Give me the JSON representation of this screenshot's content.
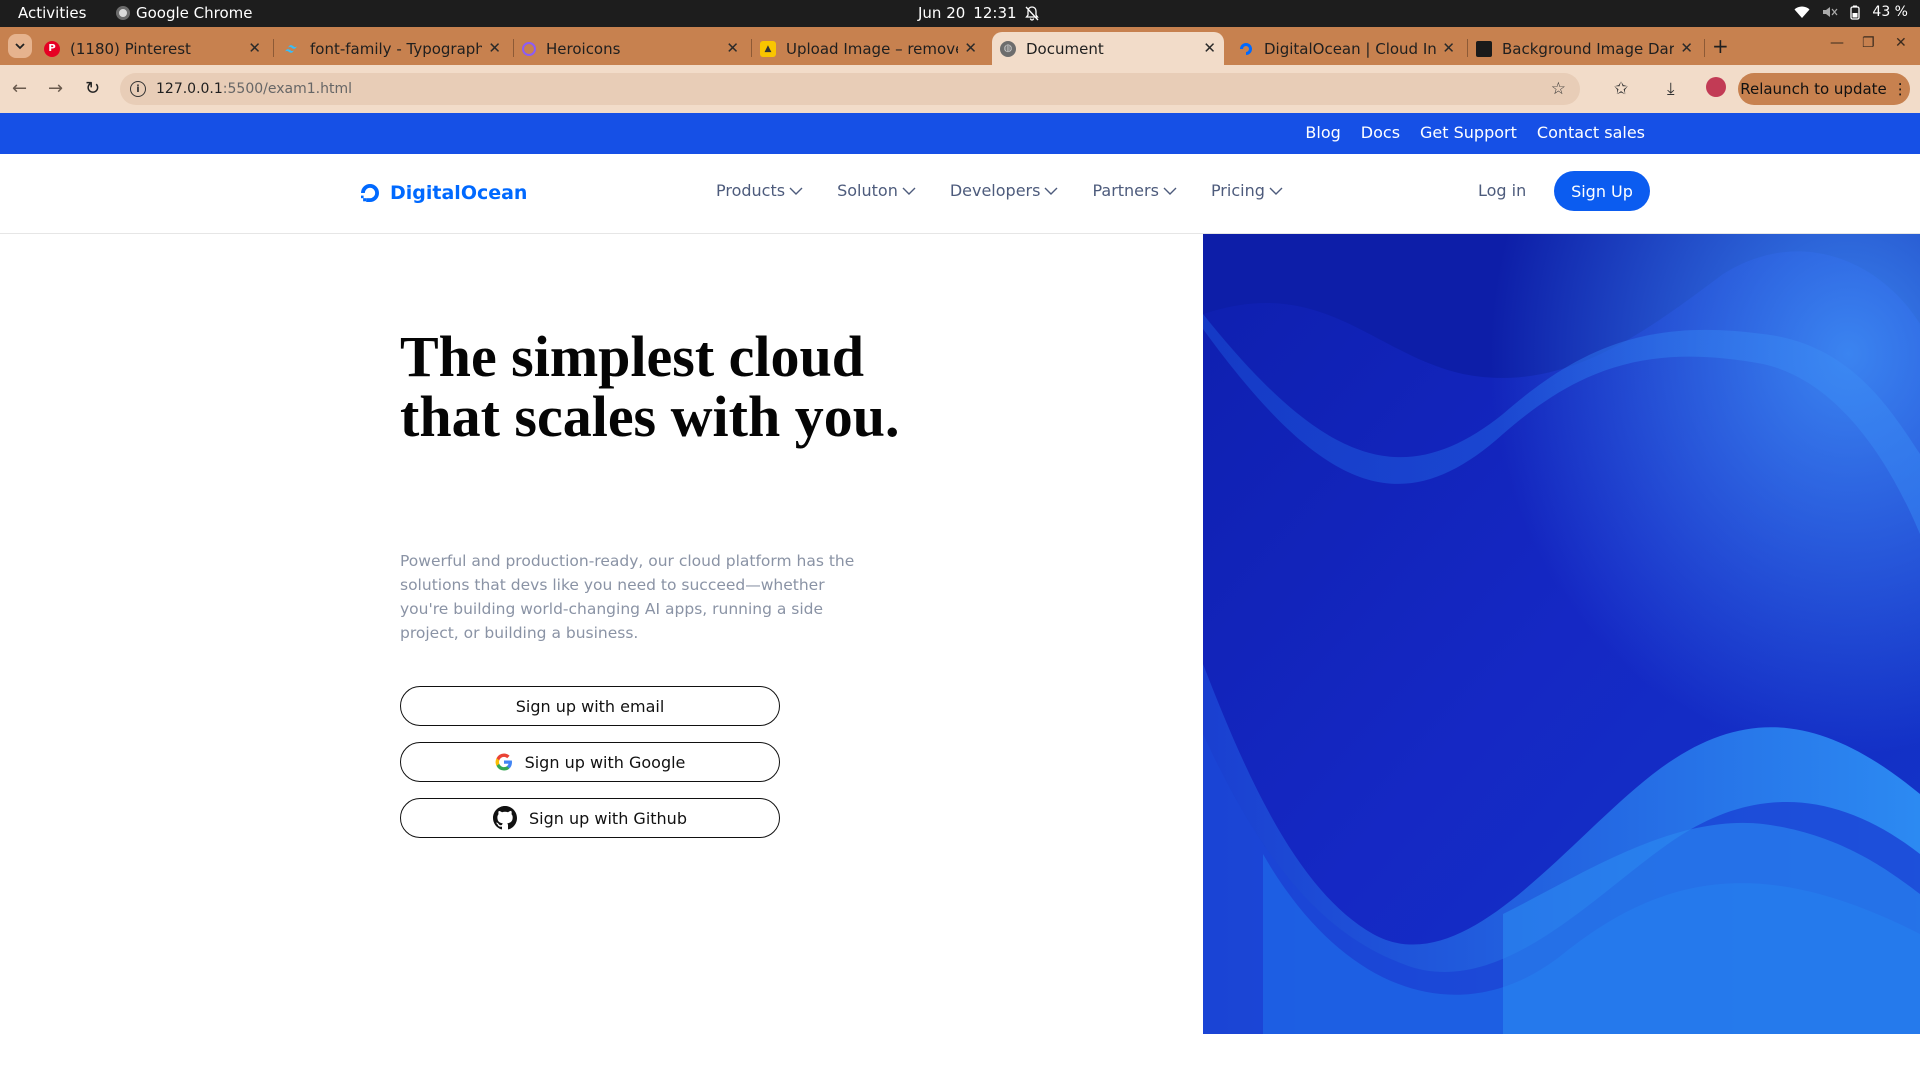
{
  "os": {
    "activities": "Activities",
    "app_name": "Google Chrome",
    "date": "Jun 20",
    "time": "12:31",
    "battery": "43 %"
  },
  "tabs": [
    {
      "title": "(1180) Pinterest",
      "icon": "pinterest-icon",
      "active": false
    },
    {
      "title": "font-family - Typography",
      "icon": "tailwind-icon",
      "active": false
    },
    {
      "title": "Heroicons",
      "icon": "heroicons-icon",
      "active": false
    },
    {
      "title": "Upload Image – remove.bg",
      "icon": "removebg-icon",
      "active": false
    },
    {
      "title": "Document",
      "icon": "globe-icon",
      "active": true
    },
    {
      "title": "DigitalOcean | Cloud Infrastructure",
      "icon": "digitalocean-icon",
      "active": false
    },
    {
      "title": "Background Image Dark",
      "icon": "freepik-icon",
      "active": false
    }
  ],
  "toolbar": {
    "url_host": "127.0.0.1",
    "url_path": ":5500/exam1.html",
    "relaunch_label": "Relaunch to update"
  },
  "page": {
    "top_links": [
      "Blog",
      "Docs",
      "Get Support",
      "Contact sales"
    ],
    "logo_text": "DigitalOcean",
    "nav_items": [
      "Products",
      "Soluton",
      "Developers",
      "Partners",
      "Pricing"
    ],
    "login_label": "Log in",
    "signup_label": "Sign Up",
    "hero_title": "The simplest cloud that scales with you.",
    "hero_desc": "Powerful and production-ready, our cloud platform has the solutions that devs like you need to succeed—whether you're building world-changing AI apps, running a side project, or building a business.",
    "cta_email": "Sign up with email",
    "cta_google": "Sign up with Google",
    "cta_github": "Sign up with Github"
  },
  "colors": {
    "tab_strip": "#c7814f",
    "toolbar": "#f2dcc9",
    "top_strip": "#1650e6",
    "brand_blue": "#0069ff",
    "signup_button": "#0b5cf0",
    "hero_art_base": "#1226b8"
  }
}
